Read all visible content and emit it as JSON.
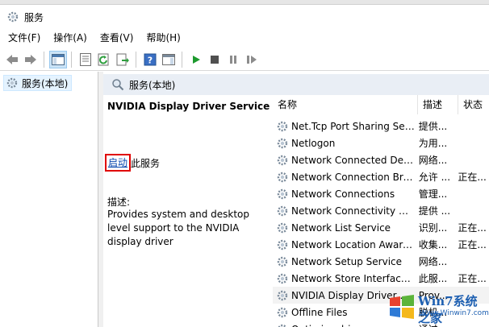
{
  "window": {
    "title": "服务",
    "icon": "gear-icon"
  },
  "menu": [
    "文件(F)",
    "操作(A)",
    "查看(V)",
    "帮助(H)"
  ],
  "toolbar": {
    "icons": [
      "back-arrow-icon",
      "forward-arrow-icon",
      "console-tree-icon",
      "properties-icon",
      "refresh-icon",
      "export-list-icon",
      "help-icon",
      "action-pane-icon",
      "start-service-icon",
      "stop-service-icon",
      "pause-service-icon",
      "restart-service-icon"
    ]
  },
  "tree": {
    "root_label": "服务(本地)"
  },
  "pane": {
    "header": "服务(本地)",
    "service_name": "NVIDIA Display Driver Service",
    "start_link": "启动",
    "start_suffix": "此服务",
    "description_label": "描述:",
    "description": "Provides system and desktop level support to the NVIDIA display driver"
  },
  "list": {
    "columns": [
      "名称",
      "描述",
      "状态"
    ],
    "rows": [
      {
        "name": "Net.Tcp Port Sharing Ser...",
        "desc": "提供...",
        "status": ""
      },
      {
        "name": "Netlogon",
        "desc": "为用...",
        "status": ""
      },
      {
        "name": "Network Connected Devi...",
        "desc": "网络...",
        "status": ""
      },
      {
        "name": "Network Connection Bro...",
        "desc": "允许 ...",
        "status": "正在..."
      },
      {
        "name": "Network Connections",
        "desc": "管理...",
        "status": ""
      },
      {
        "name": "Network Connectivity Ass...",
        "desc": "提供 ...",
        "status": ""
      },
      {
        "name": "Network List Service",
        "desc": "识别...",
        "status": "正在..."
      },
      {
        "name": "Network Location Aware...",
        "desc": "收集...",
        "status": "正在..."
      },
      {
        "name": "Network Setup Service",
        "desc": "网络...",
        "status": ""
      },
      {
        "name": "Network Store Interface ...",
        "desc": "此服...",
        "status": "正在..."
      },
      {
        "name": "NVIDIA Display Driver S...",
        "desc": "Prov...",
        "status": ""
      },
      {
        "name": "Offline Files",
        "desc": "脱机...",
        "status": ""
      },
      {
        "name": "Optimize drives",
        "desc": "通过...",
        "status": ""
      }
    ]
  },
  "watermark": {
    "title": "Win7系统之家",
    "url": "Www.Winwin7.com"
  },
  "colors": {
    "link": "#0645ad",
    "highlight_box": "#e00000",
    "header_bg": "#e9eef5",
    "selection": "#e5f3ff"
  }
}
